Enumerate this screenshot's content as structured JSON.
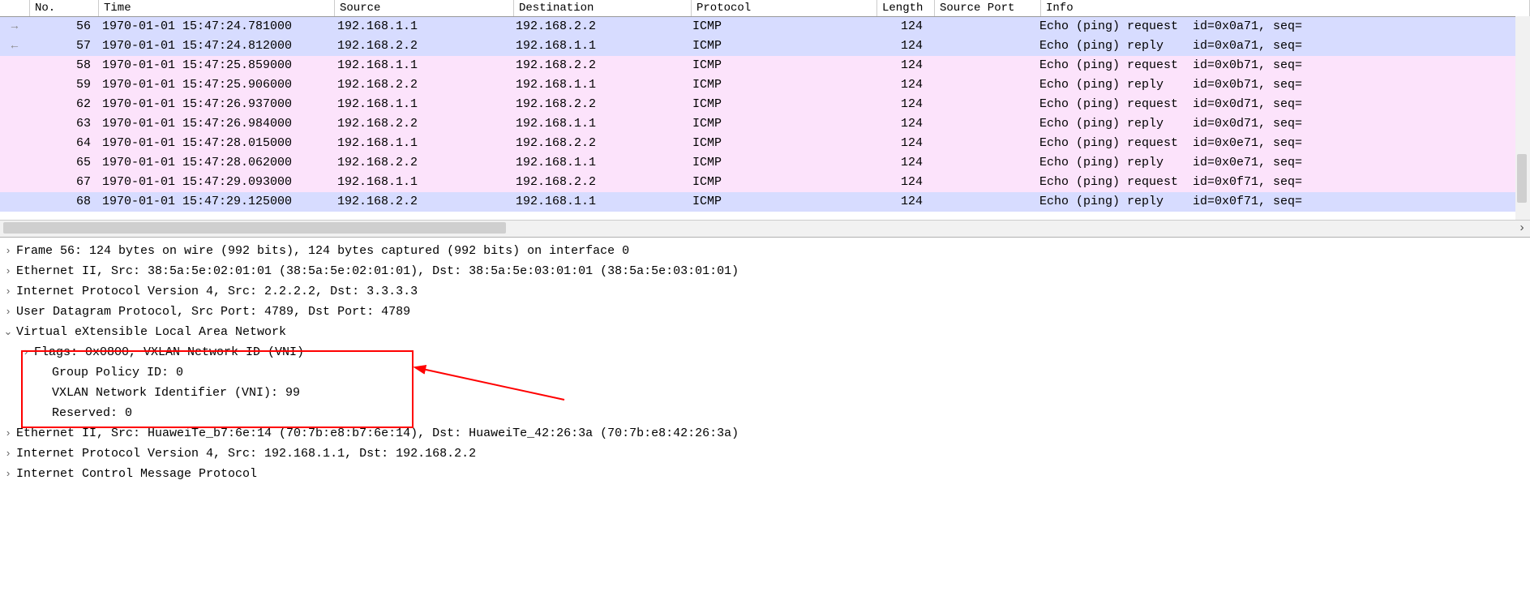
{
  "columns": {
    "no": "No.",
    "time": "Time",
    "source": "Source",
    "destination": "Destination",
    "protocol": "Protocol",
    "length": "Length",
    "source_port": "Source Port",
    "info": "Info"
  },
  "rows": [
    {
      "arrow": "→",
      "no": "56",
      "time": "1970-01-01 15:47:24.781000",
      "src": "192.168.1.1",
      "dst": "192.168.2.2",
      "proto": "ICMP",
      "len": "124",
      "sport": "",
      "info": "Echo (ping) request  id=0x0a71, seq=",
      "cls": "blue"
    },
    {
      "arrow": "←",
      "no": "57",
      "time": "1970-01-01 15:47:24.812000",
      "src": "192.168.2.2",
      "dst": "192.168.1.1",
      "proto": "ICMP",
      "len": "124",
      "sport": "",
      "info": "Echo (ping) reply    id=0x0a71, seq=",
      "cls": "blue"
    },
    {
      "arrow": "",
      "no": "58",
      "time": "1970-01-01 15:47:25.859000",
      "src": "192.168.1.1",
      "dst": "192.168.2.2",
      "proto": "ICMP",
      "len": "124",
      "sport": "",
      "info": "Echo (ping) request  id=0x0b71, seq=",
      "cls": "pink"
    },
    {
      "arrow": "",
      "no": "59",
      "time": "1970-01-01 15:47:25.906000",
      "src": "192.168.2.2",
      "dst": "192.168.1.1",
      "proto": "ICMP",
      "len": "124",
      "sport": "",
      "info": "Echo (ping) reply    id=0x0b71, seq=",
      "cls": "pink"
    },
    {
      "arrow": "",
      "no": "62",
      "time": "1970-01-01 15:47:26.937000",
      "src": "192.168.1.1",
      "dst": "192.168.2.2",
      "proto": "ICMP",
      "len": "124",
      "sport": "",
      "info": "Echo (ping) request  id=0x0d71, seq=",
      "cls": "pink"
    },
    {
      "arrow": "",
      "no": "63",
      "time": "1970-01-01 15:47:26.984000",
      "src": "192.168.2.2",
      "dst": "192.168.1.1",
      "proto": "ICMP",
      "len": "124",
      "sport": "",
      "info": "Echo (ping) reply    id=0x0d71, seq=",
      "cls": "pink"
    },
    {
      "arrow": "",
      "no": "64",
      "time": "1970-01-01 15:47:28.015000",
      "src": "192.168.1.1",
      "dst": "192.168.2.2",
      "proto": "ICMP",
      "len": "124",
      "sport": "",
      "info": "Echo (ping) request  id=0x0e71, seq=",
      "cls": "pink"
    },
    {
      "arrow": "",
      "no": "65",
      "time": "1970-01-01 15:47:28.062000",
      "src": "192.168.2.2",
      "dst": "192.168.1.1",
      "proto": "ICMP",
      "len": "124",
      "sport": "",
      "info": "Echo (ping) reply    id=0x0e71, seq=",
      "cls": "pink"
    },
    {
      "arrow": "",
      "no": "67",
      "time": "1970-01-01 15:47:29.093000",
      "src": "192.168.1.1",
      "dst": "192.168.2.2",
      "proto": "ICMP",
      "len": "124",
      "sport": "",
      "info": "Echo (ping) request  id=0x0f71, seq=",
      "cls": "pink"
    },
    {
      "arrow": "",
      "no": "68",
      "time": "1970-01-01 15:47:29.125000",
      "src": "192.168.2.2",
      "dst": "192.168.1.1",
      "proto": "ICMP",
      "len": "124",
      "sport": "",
      "info": "Echo (ping) reply    id=0x0f71, seq=",
      "cls": "blue"
    }
  ],
  "details": {
    "frame": "Frame 56: 124 bytes on wire (992 bits), 124 bytes captured (992 bits) on interface 0",
    "eth1": "Ethernet II, Src: 38:5a:5e:02:01:01 (38:5a:5e:02:01:01), Dst: 38:5a:5e:03:01:01 (38:5a:5e:03:01:01)",
    "ip1": "Internet Protocol Version 4, Src: 2.2.2.2, Dst: 3.3.3.3",
    "udp": "User Datagram Protocol, Src Port: 4789, Dst Port: 4789",
    "vxlan": "Virtual eXtensible Local Area Network",
    "flags": "Flags: 0x0800, VXLAN Network ID (VNI)",
    "gpid": "Group Policy ID: 0",
    "vni": "VXLAN Network Identifier (VNI): 99",
    "reserved": "Reserved: 0",
    "eth2": "Ethernet II, Src: HuaweiTe_b7:6e:14 (70:7b:e8:b7:6e:14), Dst: HuaweiTe_42:26:3a (70:7b:e8:42:26:3a)",
    "ip2": "Internet Protocol Version 4, Src: 192.168.1.1, Dst: 192.168.2.2",
    "icmp": "Internet Control Message Protocol"
  },
  "twist": {
    "closed": "›",
    "open": "⌄"
  }
}
